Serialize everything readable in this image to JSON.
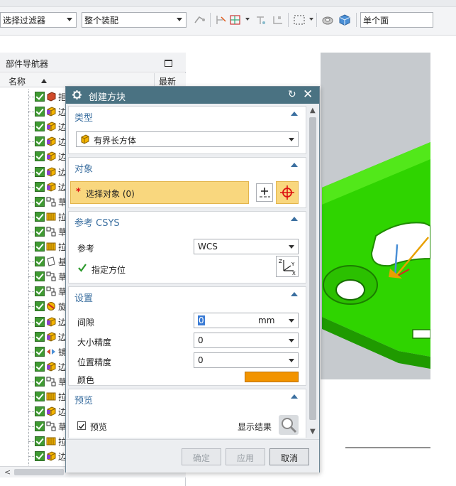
{
  "toolbar": {
    "filter_value": "选择过滤器",
    "scope_value": "整个装配",
    "face_rule_value": "单个面"
  },
  "navigator": {
    "title": "部件导航器",
    "col_name": "名称",
    "col_latest": "最新",
    "rows": [
      {
        "icon": "block-feature-icon",
        "text": "拒"
      },
      {
        "icon": "edge-feature-icon",
        "text": "边"
      },
      {
        "icon": "edge-feature-icon",
        "text": "边"
      },
      {
        "icon": "edge-feature-icon",
        "text": "边"
      },
      {
        "icon": "edge-feature-icon",
        "text": "边"
      },
      {
        "icon": "edge-feature-icon",
        "text": "边"
      },
      {
        "icon": "edge-feature-icon",
        "text": "边"
      },
      {
        "icon": "sketch-icon",
        "text": "草"
      },
      {
        "icon": "extrude-icon",
        "text": "拉"
      },
      {
        "icon": "sketch-icon",
        "text": "草"
      },
      {
        "icon": "extrude-icon",
        "text": "拉"
      },
      {
        "icon": "datum-plane-icon",
        "text": "基"
      },
      {
        "icon": "sketch-icon",
        "text": "草"
      },
      {
        "icon": "sketch-icon",
        "text": "草"
      },
      {
        "icon": "revolve-icon",
        "text": "旋"
      },
      {
        "icon": "edge-feature-icon",
        "text": "边"
      },
      {
        "icon": "edge-feature-icon",
        "text": "边"
      },
      {
        "icon": "mirror-icon",
        "text": "镜"
      },
      {
        "icon": "edge-feature-icon",
        "text": "边"
      },
      {
        "icon": "sketch-icon",
        "text": "草"
      },
      {
        "icon": "extrude-icon",
        "text": "拉"
      },
      {
        "icon": "edge-feature-icon",
        "text": "边"
      },
      {
        "icon": "sketch-icon",
        "text": "草"
      },
      {
        "icon": "extrude-icon",
        "text": "拉"
      },
      {
        "icon": "edge-feature-icon",
        "text": "边"
      }
    ]
  },
  "dialog": {
    "title": "创建方块",
    "type_group": {
      "header": "类型",
      "value": "有界长方体"
    },
    "object_group": {
      "header": "对象",
      "select_label": "选择对象 (0)"
    },
    "csys_group": {
      "header": "参考 CSYS",
      "ref_label": "参考",
      "ref_value": "WCS",
      "orient_label": "指定方位"
    },
    "settings_group": {
      "header": "设置",
      "clearance_label": "间隙",
      "clearance_value": "0",
      "clearance_unit": "mm",
      "size_precision_label": "大小精度",
      "size_precision_value": "0",
      "position_precision_label": "位置精度",
      "position_precision_value": "0",
      "color_label": "颜色",
      "color_value": "#f29400"
    },
    "preview_group": {
      "header": "预览",
      "preview_label": "预览",
      "preview_checked": true,
      "show_result_label": "显示结果"
    },
    "buttons": {
      "ok": "确定",
      "apply": "应用",
      "cancel": "取消"
    }
  },
  "colors": {
    "title_bar": "#4a7282",
    "header_blue": "#3b6fa0",
    "model_green": "#2fd400",
    "selection_yellow": "#f9d77e"
  }
}
